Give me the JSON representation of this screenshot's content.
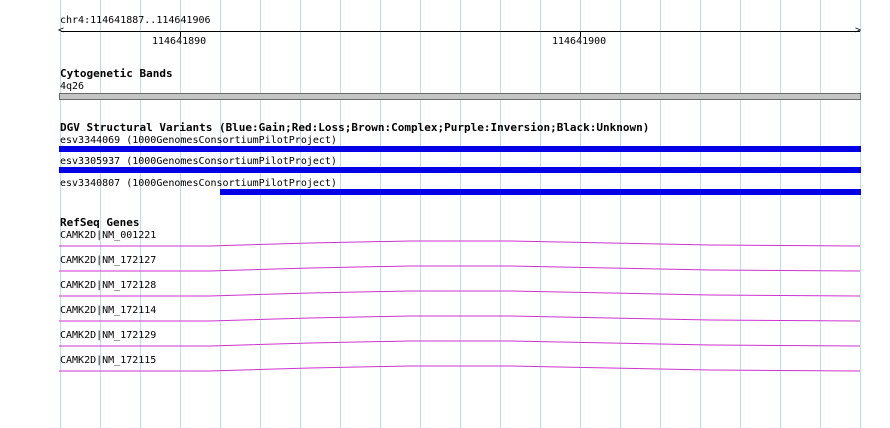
{
  "ruler": {
    "position_label": "chr4:114641887..114641906",
    "tick_labels": [
      "114641890",
      "114641900"
    ]
  },
  "cytoband_track": {
    "title": "Cytogenetic Bands",
    "band_label": "4q26",
    "band_color": "#c4c4c4"
  },
  "dgv_track": {
    "title": "DGV Structural Variants (Blue:Gain;Red:Loss;Brown:Complex;Purple:Inversion;Black:Unknown)",
    "color": "#0000e6",
    "variants": [
      {
        "label": "esv3344069 (1000GenomesConsortiumPilotProject)"
      },
      {
        "label": "esv3305937 (1000GenomesConsortiumPilotProject)"
      },
      {
        "label": "esv3340807 (1000GenomesConsortiumPilotProject)"
      }
    ]
  },
  "refseq_track": {
    "title": "RefSeq Genes",
    "color": "#cc33cc",
    "genes": [
      {
        "label": "CAMK2D|NM_001221"
      },
      {
        "label": "CAMK2D|NM_172127"
      },
      {
        "label": "CAMK2D|NM_172128"
      },
      {
        "label": "CAMK2D|NM_172114"
      },
      {
        "label": "CAMK2D|NM_172129"
      },
      {
        "label": "CAMK2D|NM_172115"
      }
    ]
  }
}
